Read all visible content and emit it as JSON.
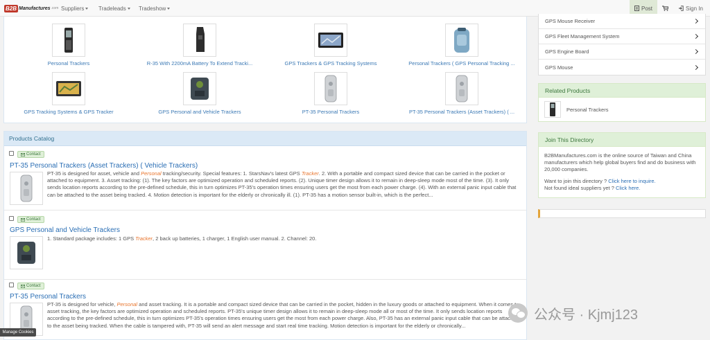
{
  "brand": {
    "logo_b2b": "B2B",
    "logo_rest": "Manufactures",
    "logo_com": ".com"
  },
  "nav": {
    "suppliers": "Suppliers",
    "tradeleads": "Tradeleads",
    "tradeshow": "Tradeshow",
    "post": "Post",
    "sign_in": "Sign In"
  },
  "gallery": [
    {
      "label": "Personal Trackers",
      "icon": "phone-tracker-icon"
    },
    {
      "label": "R-35 With 2200mA Battery To Extend Tracki...",
      "icon": "handheld-tracker-icon"
    },
    {
      "label": "GPS Trackers & GPS Tracking Systems",
      "icon": "gps-navigator-icon"
    },
    {
      "label": "Personal Trackers ( GPS Personal Tracking ...",
      "icon": "blue-tracker-icon"
    },
    {
      "label": "GPS Tracking Systems & GPS Tracker",
      "icon": "gps-navigator-icon"
    },
    {
      "label": "GPS Personal and Vehicle Trackers",
      "icon": "vehicle-tracker-icon"
    },
    {
      "label": "PT-35 Personal Trackers",
      "icon": "silver-tracker-icon"
    },
    {
      "label": "PT-35 Personal Trackers (Asset Trackers) ( ...",
      "icon": "silver-tracker-icon"
    }
  ],
  "catalog": {
    "title": "Products Catalog",
    "contact_label": "Contact",
    "products": [
      {
        "title": "PT-35 Personal Trackers (Asset Trackers) ( Vehicle Trackers)",
        "desc_parts": [
          "PT-35 is designed for asset, vehicle and ",
          "Personal",
          " tracking/security. Special features: 1. StarsNav's latest GPS ",
          "Tracker",
          ". 2. With a portable and compact sized device that can be carried in the pocket or attached to equipment. 3. Asset tracking: (1). The key factors are optimized operation and scheduled reports. (2). Unique timer design allows it to remain in deep-sleep mode most of the time. (3). It only sends location reports according to the pre-defined schedule, this in turn optimizes PT-35's operation times ensuring users get the most from each power charge. (4). With an external panic input cable that can be attached to the asset being tracked. 4. Motion detection is important for the elderly or chronically ill. (1). PT-35 has a motion sensor built-in, which is the perfect..."
        ]
      },
      {
        "title": "GPS Personal and Vehicle Trackers",
        "desc_parts": [
          "1. Standard package includes: 1 GPS ",
          "Tracker",
          ", 2 back up batteries, 1 charger, 1 English user manual. 2. Channel: 20."
        ]
      },
      {
        "title": "PT-35 Personal Trackers",
        "desc_parts": [
          "PT-35 is designed for vehicle, ",
          "Personal",
          " and asset tracking. It is a portable and compact sized device that can be carried in the pocket, hidden in the luxury goods or attached to equipment. When it comes to asset tracking, the key factors are optimized operation and scheduled reports. PT-35's unique timer design allows it to remain in deep-sleep mode all or most of the time. It only sends location reports according to the pre-defined schedule, this in turn optimizes PT-35's operation times ensuring users get the most from each power charge. Also, PT-35 has an external panic input cable that can be attached to the asset being tracked. When the cable is tampered with, PT-35 will send an alert message and start real time tracking. Motion detection is important for the elderly or chronically..."
        ]
      }
    ]
  },
  "sidebar": {
    "categories": [
      "GPS Mouse Receiver",
      "GPS Fleet Management System",
      "GPS Engine Board",
      "GPS Mouse"
    ],
    "related": {
      "title": "Related Products",
      "item": "Personal Trackers"
    },
    "join": {
      "title": "Join This Directory",
      "intro": "B2BManufactures.com is the online source of Taiwan and China manufacturers which help global buyers find and do business with 20,000 companies.",
      "want_text": "Want to join this directory ? ",
      "want_link": "Click here to inquire.",
      "notfound_text": "Not found ideal suppliers yet ? ",
      "notfound_link": "Click here."
    }
  },
  "manage_cookies": "Manage Cookies",
  "watermark": "公众号 · Kjmj123"
}
